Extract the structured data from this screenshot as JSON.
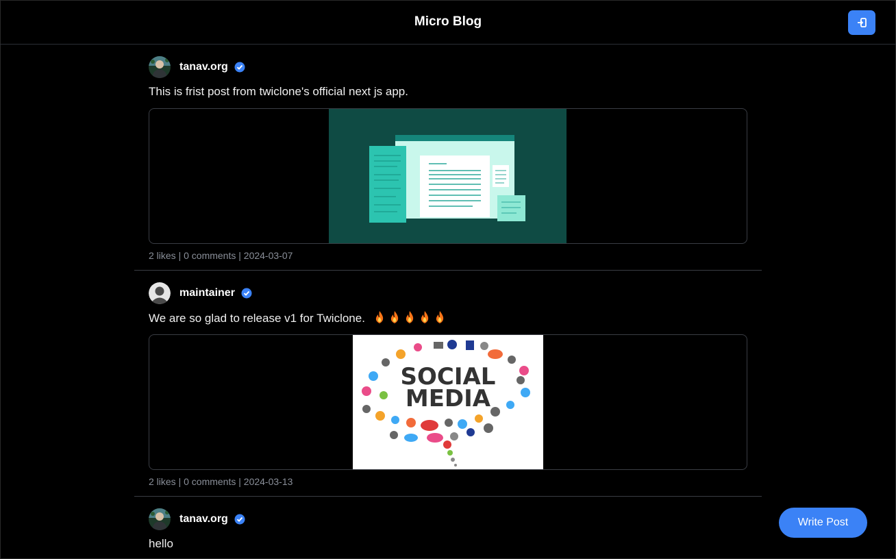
{
  "header": {
    "title": "Micro Blog",
    "login_icon": "login-icon"
  },
  "posts": [
    {
      "username": "tanav.org",
      "verified": true,
      "text": "This is frist post from twiclone's official next js app.",
      "image": "documents-illustration",
      "likes": "2 likes",
      "comments": "0 comments",
      "date": "2024-03-07",
      "separator": "|"
    },
    {
      "username": "maintainer",
      "verified": true,
      "text": "We are so glad to release v1 for Twiclone.",
      "emoji": "🔥🔥🔥🔥🔥",
      "image": "social-media-word-cloud",
      "image_text_1": "SOCIAL",
      "image_text_2": "MEDIA",
      "likes": "2 likes",
      "comments": "0 comments",
      "date": "2024-03-13",
      "separator": "|"
    },
    {
      "username": "tanav.org",
      "verified": true,
      "text": "hello"
    }
  ],
  "write_post_label": "Write Post",
  "colors": {
    "accent": "#3b82f6",
    "background": "#000000",
    "meta": "#8a8f99"
  }
}
